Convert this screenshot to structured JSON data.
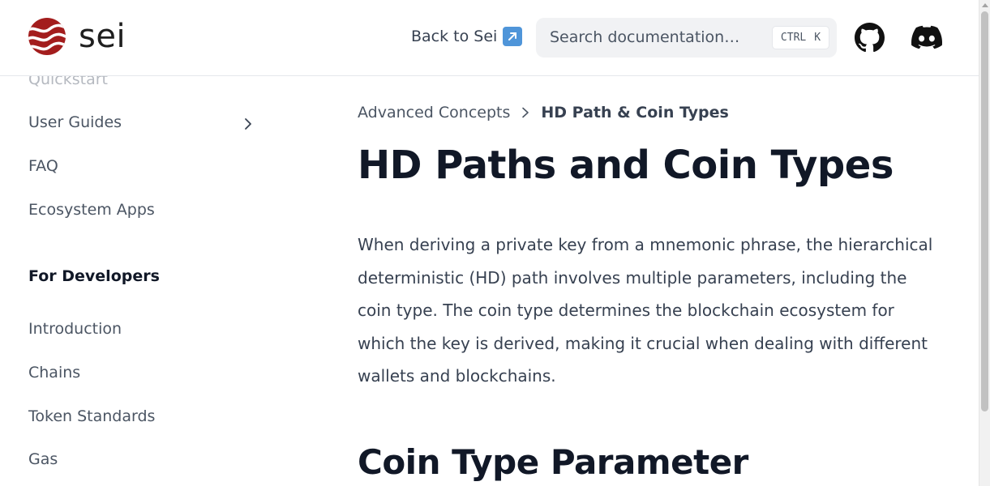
{
  "header": {
    "logo_text": "sei",
    "back_link": "Back to Sei",
    "search": {
      "placeholder": "Search documentation…",
      "shortcut_ctrl": "CTRL",
      "shortcut_key": "K"
    },
    "icons": [
      "github-icon",
      "discord-icon"
    ]
  },
  "sidebar": {
    "items_top": [
      {
        "label": "Quickstart"
      },
      {
        "label": "User Guides"
      },
      {
        "label": "FAQ"
      },
      {
        "label": "Ecosystem Apps"
      }
    ],
    "section_title": "For Developers",
    "items_dev": [
      {
        "label": "Introduction"
      },
      {
        "label": "Chains"
      },
      {
        "label": "Token Standards"
      },
      {
        "label": "Gas"
      }
    ]
  },
  "breadcrumb": {
    "parent": "Advanced Concepts",
    "current": "HD Path & Coin Types"
  },
  "content": {
    "title": "HD Paths and Coin Types",
    "intro": "When deriving a private key from a mnemonic phrase, the hierarchical deterministic (HD) path involves multiple parameters, including the coin type. The coin type determines the blockchain ecosystem for which the key is derived, making it crucial when dealing with different wallets and blockchains.",
    "section_heading": "Coin Type Parameter"
  },
  "colors": {
    "brand": "#9b1c1c",
    "text": "#111827",
    "muted": "#4b5563"
  }
}
